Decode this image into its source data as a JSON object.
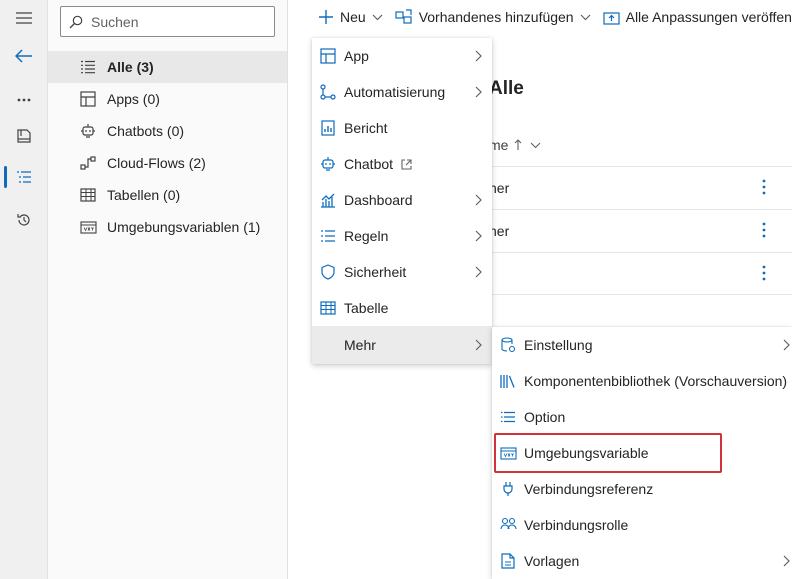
{
  "search": {
    "placeholder": "Suchen"
  },
  "tree": {
    "items": [
      {
        "label": "Alle (3)",
        "icon": "list-icon",
        "selected": true
      },
      {
        "label": "Apps (0)",
        "icon": "app-icon",
        "selected": false
      },
      {
        "label": "Chatbots (0)",
        "icon": "chatbot-icon",
        "selected": false
      },
      {
        "label": "Cloud-Flows (2)",
        "icon": "flow-icon",
        "selected": false
      },
      {
        "label": "Tabellen (0)",
        "icon": "table-icon",
        "selected": false
      },
      {
        "label": "Umgebungsvariablen (1)",
        "icon": "env-variable-icon",
        "selected": false
      }
    ]
  },
  "cmdbar": {
    "new_label": "Neu",
    "add_existing_label": "Vorhandenes hinzufügen",
    "publish_label": "Alle Anpassungen veröffentlichen"
  },
  "main": {
    "heading": "Alle",
    "column_header": "me",
    "rows": [
      "her",
      "her",
      ""
    ]
  },
  "new_menu": {
    "items": [
      {
        "label": "App",
        "icon": "app-icon",
        "submenu": true
      },
      {
        "label": "Automatisierung",
        "icon": "flow-icon",
        "submenu": true
      },
      {
        "label": "Bericht",
        "icon": "report-icon",
        "submenu": false
      },
      {
        "label": "Chatbot",
        "icon": "chatbot-icon",
        "submenu": false
      },
      {
        "label": "Dashboard",
        "icon": "dashboard-icon",
        "submenu": true
      },
      {
        "label": "Regeln",
        "icon": "rules-icon",
        "submenu": true
      },
      {
        "label": "Sicherheit",
        "icon": "shield-icon",
        "submenu": true
      },
      {
        "label": "Tabelle",
        "icon": "table-icon",
        "submenu": false
      },
      {
        "label": "Mehr",
        "icon": "",
        "submenu": true
      }
    ]
  },
  "more_menu": {
    "items": [
      {
        "label": "Einstellung",
        "icon": "setting-definition-icon",
        "submenu": true
      },
      {
        "label": "Komponentenbibliothek (Vorschauversion)",
        "icon": "library-icon",
        "submenu": false
      },
      {
        "label": "Option",
        "icon": "option-list-icon",
        "submenu": false
      },
      {
        "label": "Umgebungsvariable",
        "icon": "env-variable-icon",
        "submenu": false
      },
      {
        "label": "Verbindungsreferenz",
        "icon": "plug-icon",
        "submenu": false
      },
      {
        "label": "Verbindungsrolle",
        "icon": "people-icon",
        "submenu": false
      },
      {
        "label": "Vorlagen",
        "icon": "template-icon",
        "submenu": true
      }
    ]
  },
  "colors": {
    "accent": "#0f6cbd",
    "highlight_border": "#d13438"
  }
}
